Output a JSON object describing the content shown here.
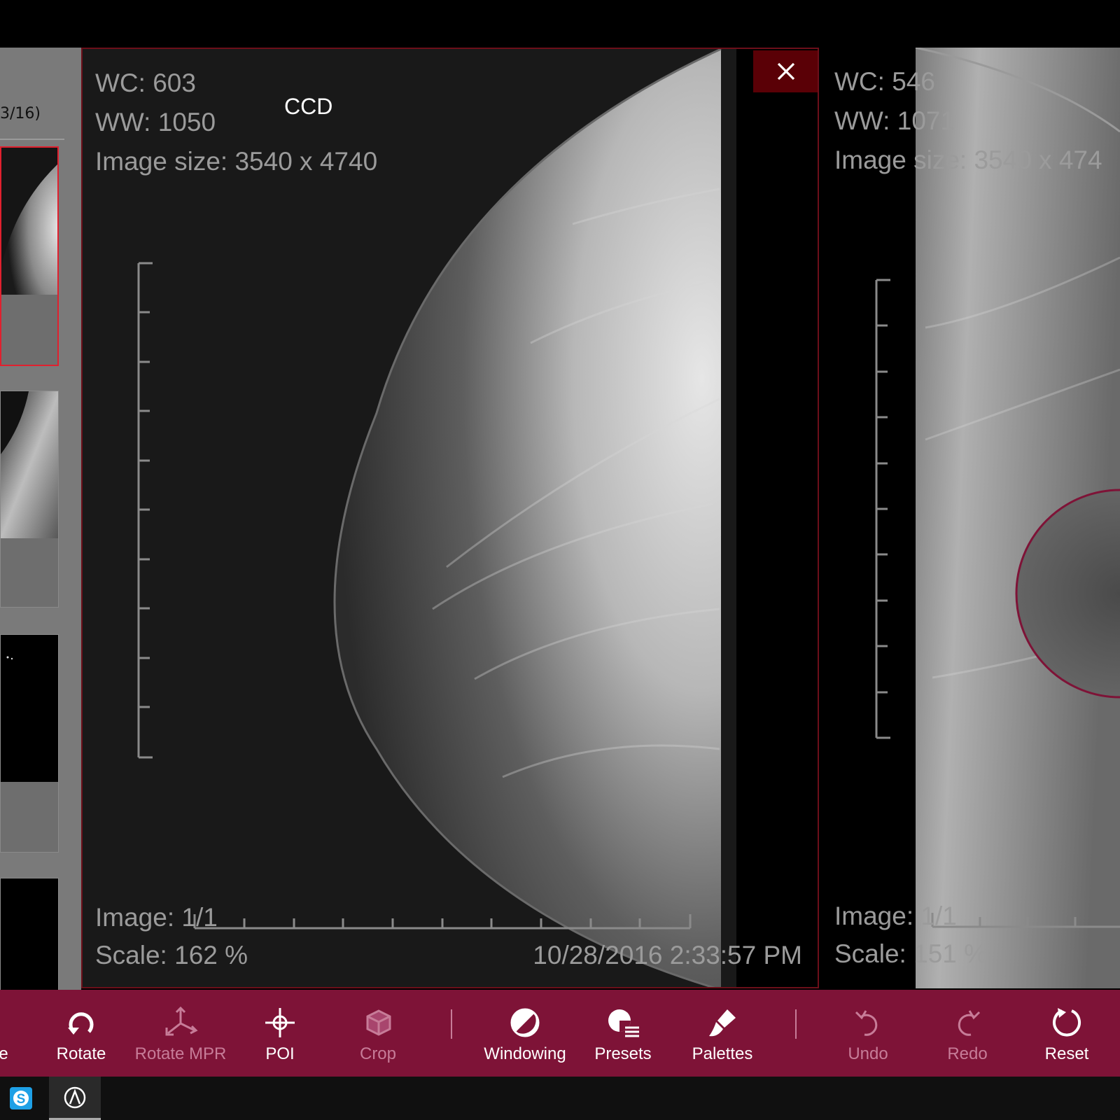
{
  "sidebar": {
    "series_count": "3/16)"
  },
  "main_viewport": {
    "wc": "WC: 603",
    "ww": "WW: 1050",
    "image_size": "Image size: 3540 x 4740",
    "label": "CCD",
    "image_index": "Image: 1/1",
    "scale": "Scale: 162 %",
    "timestamp": "10/28/2016 2:33:57 PM"
  },
  "right_viewport": {
    "wc": "WC: 546",
    "ww": "WW: 1071",
    "image_size": "Image size: 3540 x 474",
    "image_index": "Image: 1/1",
    "scale": "Scale: 151 %"
  },
  "toolbar": {
    "items": [
      {
        "label": "e",
        "icon": "cut-off-icon",
        "enabled": true
      },
      {
        "label": "Rotate",
        "icon": "rotate-icon",
        "enabled": true
      },
      {
        "label": "Rotate MPR",
        "icon": "rotate-mpr-icon",
        "enabled": false
      },
      {
        "label": "POI",
        "icon": "crosshair-icon",
        "enabled": true
      },
      {
        "label": "Crop",
        "icon": "crop-cube-icon",
        "enabled": false
      },
      {
        "label": "Windowing",
        "icon": "windowing-icon",
        "enabled": true
      },
      {
        "label": "Presets",
        "icon": "presets-icon",
        "enabled": true
      },
      {
        "label": "Palettes",
        "icon": "palette-brush-icon",
        "enabled": true
      },
      {
        "label": "Undo",
        "icon": "undo-icon",
        "enabled": false
      },
      {
        "label": "Redo",
        "icon": "redo-icon",
        "enabled": false
      },
      {
        "label": "Reset",
        "icon": "reset-icon",
        "enabled": true
      }
    ]
  },
  "taskbar": {
    "apps": [
      {
        "icon": "skype-icon"
      },
      {
        "icon": "app-logo-icon"
      }
    ]
  },
  "colors": {
    "toolbar_bg": "#7e1337",
    "viewport_border": "#6c0f1a",
    "close_bg": "#5a0006",
    "selected_thumb_border": "#e0202e"
  }
}
